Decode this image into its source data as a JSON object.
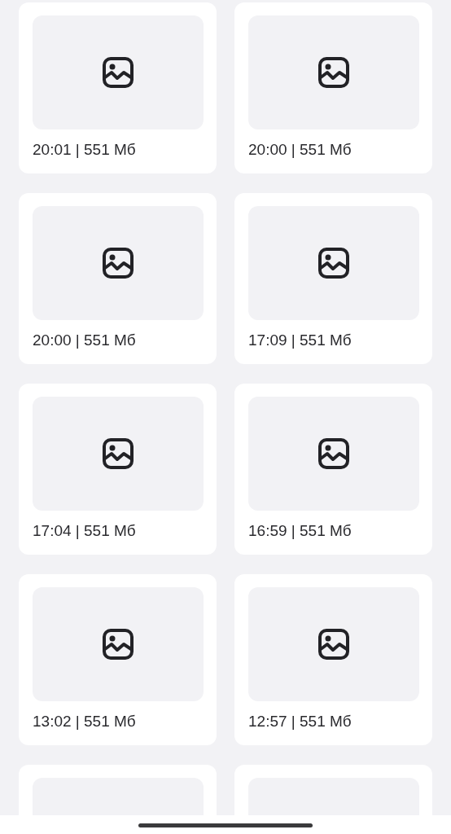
{
  "recordings": [
    {
      "kind": "full",
      "caption": "20:01 | 551 Мб"
    },
    {
      "kind": "full",
      "caption": "20:00 | 551 Мб"
    },
    {
      "kind": "full",
      "caption": "20:00 | 551 Мб"
    },
    {
      "kind": "full",
      "caption": "17:09 | 551 Мб"
    },
    {
      "kind": "full",
      "caption": "17:04 | 551 Мб"
    },
    {
      "kind": "full",
      "caption": "16:59 | 551 Мб"
    },
    {
      "kind": "full",
      "caption": "13:02 | 551 Мб"
    },
    {
      "kind": "full",
      "caption": "12:57 | 551 Мб"
    },
    {
      "kind": "cut"
    },
    {
      "kind": "cut"
    }
  ]
}
